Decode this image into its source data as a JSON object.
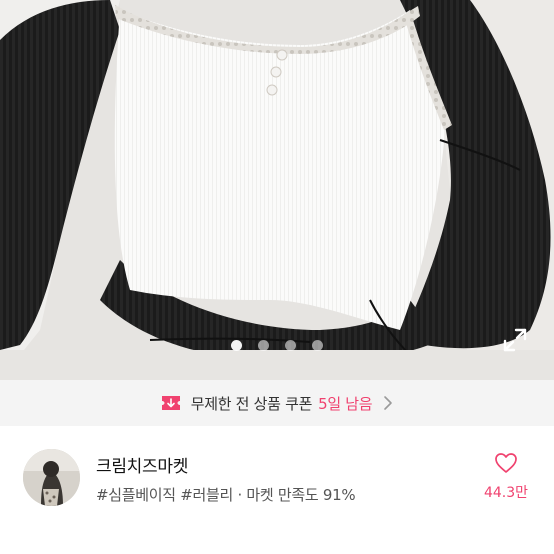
{
  "gallery": {
    "image_alt": "product photo",
    "page_count": 4,
    "current_page": 1
  },
  "coupon": {
    "text": "무제한 전 상품 쿠폰",
    "days_left": "5일 남음",
    "accent_color": "#f0426f"
  },
  "shop": {
    "name": "크림치즈마켓",
    "tags": "#심플베이직 #러블리 · 마켓 만족도 91%",
    "likes": "44.3만"
  },
  "icons": {
    "expand": "expand-icon",
    "coupon": "coupon-ticket-icon",
    "chevron": "chevron-right-icon",
    "heart": "heart-outline-icon"
  }
}
